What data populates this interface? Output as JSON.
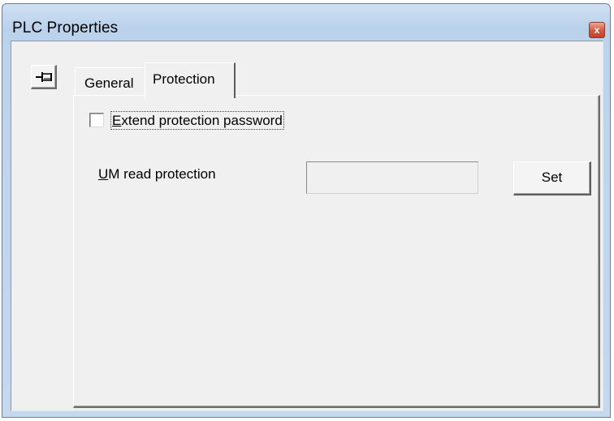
{
  "window": {
    "title": "PLC Properties",
    "close_glyph": "x"
  },
  "toolbar": {
    "pin_icon": "pin-icon"
  },
  "tabs": [
    {
      "label": "General",
      "selected": false
    },
    {
      "label": "Protection",
      "selected": true
    }
  ],
  "protection": {
    "extend_password": {
      "mnemonic": "E",
      "label_rest": "xtend protection password",
      "checked": false
    },
    "um_read": {
      "mnemonic": "U",
      "label_rest": "M read protection",
      "value": ""
    },
    "set_label": "Set"
  },
  "colors": {
    "titlebar": "#bcd4ec",
    "close_button": "#d2583f",
    "dialog_face": "#f0f0f0"
  }
}
